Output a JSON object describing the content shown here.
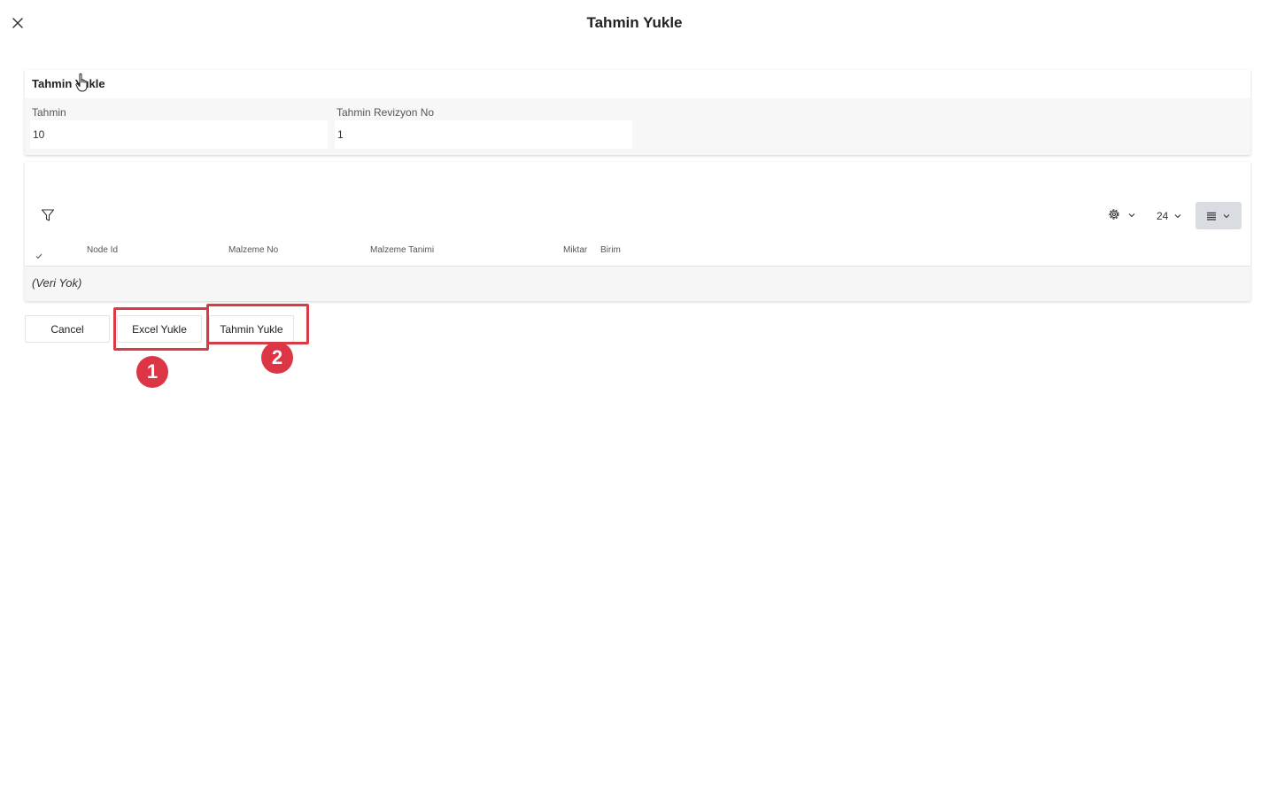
{
  "dialog": {
    "title": "Tahmin Yukle",
    "close_icon": "close-icon"
  },
  "form": {
    "section_title": "Tahmin Yukle",
    "fields": [
      {
        "label": "Tahmin",
        "value": "10"
      },
      {
        "label": "Tahmin Revizyon No",
        "value": "1"
      }
    ]
  },
  "grid": {
    "toolbar": {
      "filter_icon": "filter-icon",
      "settings_icon": "gear-icon",
      "page_size": "24",
      "density_icon": "list-density-icon"
    },
    "columns": [
      "Node Id",
      "Malzeme No",
      "Malzeme Tanimi",
      "Miktar",
      "Birim"
    ],
    "empty_text": "(Veri Yok)"
  },
  "actions": {
    "cancel_label": "Cancel",
    "excel_upload_label": "Excel Yukle",
    "forecast_upload_label": "Tahmin Yukle"
  },
  "annotations": {
    "badges": [
      "1",
      "2"
    ],
    "highlight_color": "#d93b46",
    "badge_color": "#dc3545"
  }
}
